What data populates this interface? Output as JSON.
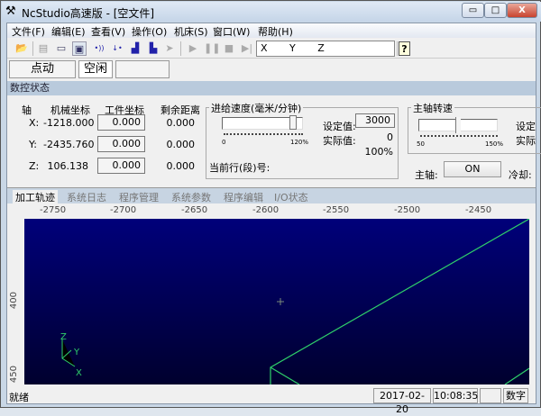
{
  "window": {
    "title": "NcStudio高速版 - [空文件]",
    "app_icon": "cnc-machine-icon",
    "minimize": "▭",
    "maximize": "□",
    "close": "X",
    "close_color": "#d9534f"
  },
  "menu": [
    "文件(F)",
    "编辑(E)",
    "查看(V)",
    "操作(O)",
    "机床(S)",
    "窗口(W)",
    "帮助(H)"
  ],
  "toolbar": {
    "icons": [
      "open-folder-icon",
      "document-icon",
      "window-icon",
      "monitor-icon",
      "probe-icon",
      "tool-measure-icon",
      "home-icon",
      "zero-icon",
      "step-icon",
      "play-icon",
      "pause-icon",
      "stop-icon",
      "step-forward-icon"
    ],
    "axes_field": "X       Y       Z",
    "help_icon": "?"
  },
  "mode": {
    "jog": "点动",
    "state": "空闲",
    "extra": ""
  },
  "section_title": "数控状态",
  "coords": {
    "headers": [
      "轴",
      "机械坐标",
      "工件坐标",
      "剩余距离"
    ],
    "rows": [
      {
        "axis": "X:",
        "machine": "-1218.000",
        "work": "0.000",
        "remain": "0.000"
      },
      {
        "axis": "Y:",
        "machine": "-2435.760",
        "work": "0.000",
        "remain": "0.000"
      },
      {
        "axis": "Z:",
        "machine": "106.138",
        "work": "0.000",
        "remain": "0.000"
      }
    ]
  },
  "feed": {
    "title": "进给速度(毫米/分钟)",
    "slider_min": "0",
    "slider_max": "120%",
    "slider_value_pct": 100,
    "set_label": "设定值:",
    "set_value": "3000",
    "actual_label": "实际值:",
    "actual_value": "0",
    "percent": "100%",
    "line_label": "当前行(段)号:"
  },
  "spindle": {
    "title": "主轴转速",
    "slider_min": "50",
    "slider_max": "150%",
    "slider_value_pct": 100,
    "set_label": "设定",
    "actual_label": "实际",
    "spindle_label": "主轴:",
    "spindle_button": "ON",
    "coolant_label": "冷却:"
  },
  "tabs": [
    "加工轨迹",
    "系统日志",
    "程序管理",
    "系统参数",
    "程序编辑",
    "I/O状态"
  ],
  "active_tab": 0,
  "ruler": {
    "x_ticks": [
      "-2750",
      "-2700",
      "-2650",
      "-2600",
      "-2550",
      "-2500",
      "-2450"
    ],
    "y_ticks": [
      "400",
      "450"
    ]
  },
  "view": {
    "bg_top": "#00007a",
    "bg_bottom": "#00002e",
    "path_color": "#2fd06a",
    "axis_labels": [
      "Z",
      "Y",
      "X"
    ]
  },
  "status": {
    "text": "就绪",
    "date": "2017-02-20",
    "time": "10:08:35",
    "blank": "",
    "numlock": "数字"
  }
}
